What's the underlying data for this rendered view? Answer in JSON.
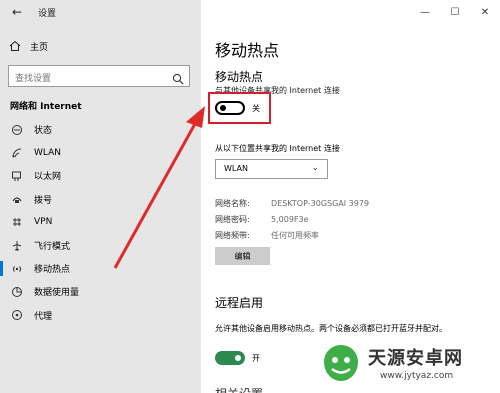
{
  "app": {
    "title": "设置",
    "back_icon": "back-arrow-icon"
  },
  "sidebar": {
    "home_label": "主页",
    "search_placeholder": "查找设置",
    "section_title": "网络和 Internet",
    "items": [
      {
        "label": "状态",
        "icon": "status-icon"
      },
      {
        "label": "WLAN",
        "icon": "wifi-icon"
      },
      {
        "label": "以太网",
        "icon": "ethernet-icon"
      },
      {
        "label": "拨号",
        "icon": "dialup-icon"
      },
      {
        "label": "VPN",
        "icon": "vpn-icon"
      },
      {
        "label": "飞行模式",
        "icon": "airplane-icon"
      },
      {
        "label": "移动热点",
        "icon": "hotspot-icon"
      },
      {
        "label": "数据使用量",
        "icon": "data-usage-icon"
      },
      {
        "label": "代理",
        "icon": "proxy-icon"
      }
    ],
    "selected_index": 6
  },
  "main": {
    "page_title": "移动热点",
    "hotspot": {
      "title": "移动热点",
      "description": "与其他设备共享我的 Internet 连接",
      "toggle_state": "关"
    },
    "share_from": {
      "label": "从以下位置共享我的 Internet 连接",
      "selected": "WLAN"
    },
    "network_info": [
      {
        "key": "网络名称:",
        "value": "DESKTOP-30GSGAI 3979"
      },
      {
        "key": "网络密码:",
        "value": "5,009F3e"
      },
      {
        "key": "网络频带:",
        "value": "任何可用频率"
      }
    ],
    "edit_label": "编辑",
    "remote": {
      "title": "远程启用",
      "description": "允许其他设备启用移动热点。两个设备必须都已打开蓝牙并配对。",
      "toggle_state": "开"
    },
    "next_section_title": "相关设置"
  },
  "watermark": {
    "title": "天源安卓网",
    "url": "www.jytyaz.com"
  },
  "colors": {
    "sidebar_bg": "#e6e6e6",
    "accent": "#0078d7",
    "highlight": "#d02030",
    "toggle_on": "#2d8a4e"
  }
}
